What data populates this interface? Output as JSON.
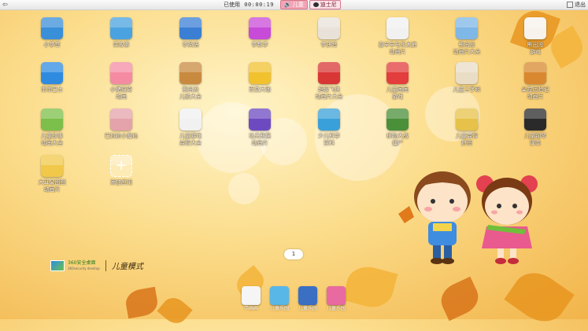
{
  "topbar": {
    "back_icon": "back-arrow-icon",
    "used_label": "已使用",
    "used_time": "00:00:19",
    "tabs": [
      {
        "label": "儿童",
        "icon": "speaker-icon",
        "active": true
      },
      {
        "label": "迪士尼",
        "icon": "mickey-icon",
        "active": false
      }
    ],
    "exit_label": "退出"
  },
  "apps": [
    {
      "label": "小学堂",
      "color": "#3a8fd9",
      "icon": "school-hat-icon"
    },
    {
      "label": "讲故事",
      "color": "#4aa3e0",
      "icon": "story-tv-icon"
    },
    {
      "label": "学英语",
      "color": "#3b7fd4",
      "icon": "english-icon"
    },
    {
      "label": "学数学",
      "color": "#c84ad8",
      "icon": "math-icon"
    },
    {
      "label": "学拼音",
      "color": "#e8e2d8",
      "icon": "book-icon"
    },
    {
      "label": "喜羊羊与灰太狼\n动画片",
      "color": "#f1f1f1",
      "icon": "sheep-icon"
    },
    {
      "label": "熊出没\n动画片大全",
      "color": "#7fb7e6",
      "icon": "bear-icon"
    },
    {
      "label": "熊出没\n游戏",
      "color": "#f7f2ec",
      "icon": "bear-face-icon"
    },
    {
      "label": "宝宝巴士",
      "color": "#2f8be0",
      "icon": "bus-icon"
    },
    {
      "label": "小猪佩奇\n动画",
      "color": "#f48ba3",
      "icon": "pig-icon"
    },
    {
      "label": "熊出没\n儿歌大全",
      "color": "#c88a3f",
      "icon": "bear-song-icon"
    },
    {
      "label": "百变大咖",
      "color": "#f2c12e",
      "icon": "puzzle-icon"
    },
    {
      "label": "超级飞侠\n动画片大全",
      "color": "#d93636",
      "icon": "robot-icon"
    },
    {
      "label": "儿童画画\n游戏",
      "color": "#e33d3d",
      "icon": "flower-icon"
    },
    {
      "label": "儿童三字经",
      "color": "#e9ddc6",
      "icon": "scroll-icon"
    },
    {
      "label": "朵拉历险记\n动画片",
      "color": "#d9882f",
      "icon": "dora-icon"
    },
    {
      "label": "儿童故事\n动画大全",
      "color": "#7cbf4a",
      "icon": "castle-icon"
    },
    {
      "label": "巴拉拉小魔仙",
      "color": "#e4a2ab",
      "icon": "fairy-icon"
    },
    {
      "label": "儿童游戏\n益智大全",
      "color": "#f1f1f1",
      "icon": "gamepad-icon"
    },
    {
      "label": "功夫熊猫\n动画片",
      "color": "#6e4ac0",
      "icon": "panda-icon"
    },
    {
      "label": "少儿科学\n百科",
      "color": "#3aa0d9",
      "icon": "science-icon"
    },
    {
      "label": "植物大战\n僵尸",
      "color": "#4a8f3a",
      "icon": "plant-icon"
    },
    {
      "label": "儿童益智\n拼图",
      "color": "#e7c24a",
      "icon": "puzzle-kid-icon"
    },
    {
      "label": "儿童钢琴\n弹奏",
      "color": "#2a2a2a",
      "icon": "piano-icon"
    },
    {
      "label": "大耳朵图图\n动画片",
      "color": "#f2c84a",
      "icon": "tutu-icon"
    },
    {
      "label": "添加应用",
      "add": true,
      "icon": "plus-icon"
    }
  ],
  "brand": {
    "logo_icon": "desktop-logo-icon",
    "name": "360安全桌面",
    "sub": "360security desktop",
    "mode": "儿童模式"
  },
  "pager": {
    "page": "1"
  },
  "dock": [
    {
      "label": "学画画",
      "color": "#f5f5f5",
      "icon": "pencil-icon"
    },
    {
      "label": "儿童乐园",
      "color": "#59b7e8",
      "icon": "park-icon"
    },
    {
      "label": "儿童乐园",
      "color": "#3a6fc4",
      "icon": "boy-icon"
    },
    {
      "label": "儿童乐园",
      "color": "#e86aa0",
      "icon": "castle-dock-icon"
    }
  ]
}
